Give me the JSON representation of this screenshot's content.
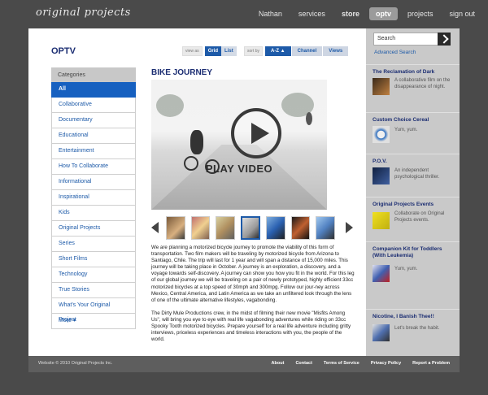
{
  "site": {
    "logo": "original projects"
  },
  "nav": {
    "items": [
      "Nathan",
      "services",
      "store",
      "optv",
      "projects",
      "sign out"
    ],
    "active": "optv"
  },
  "page": {
    "title": "OPTV"
  },
  "view": {
    "label": "view as",
    "grid": "Grid",
    "list": "List"
  },
  "sort": {
    "label": "sort by",
    "options": [
      "A-Z ▲",
      "Channel",
      "Views"
    ]
  },
  "categories": {
    "header": "Categories",
    "items": [
      "All",
      "Collaborative",
      "Documentary",
      "Educational",
      "Entertainment",
      "How To Collaborate",
      "Informational",
      "Inspirational",
      "Kids",
      "Original Projects",
      "Series",
      "Short Films",
      "Technology",
      "True Stories",
      "What's Your Original Project",
      "More ▾"
    ],
    "selected": "All"
  },
  "video": {
    "title": "BIKE JOURNEY",
    "play_label": "PLAY VIDEO",
    "thumbnail_count": 7,
    "selected_thumbnail": 4
  },
  "description": {
    "p1": "We are planning a motorized bicycle journey to promote the viability of this form of transportation. Two film makers will be traveling by motorized bicycle from Arizona to Santiago, Chile. The trip will last for 1 year and will span a distance of 15,000 miles. This journey will be taking place in October. A journey is an exploration, a discovery, and a voyage towards self-discovery. A journey can show you how you fit in the world. For this leg of our global journey we will be traveling on a pair of newly prototyped, highly efficient 33cc motorized bicycles at a top speed of 30mph and 300mpg. Follow our jour-ney across Mexico, Central America, and Latin America as we take an unfiltered look through the lens of one of the ultimate alternative lifestyles, vagabonding.",
    "p2": "The Dirty Mule Productions crew, in the midst of filming their new movie \"Misfits Among Us\", will bring you eye to eye with real life vagabonding adventures while riding on 33cc Spooky Tooth motorized bicycles. Prepare yourself for a real life adventure including gritty interviews, priceless experiences and timeless interactions with you, the people of the world."
  },
  "search": {
    "placeholder": "Search",
    "value": "Search",
    "advanced": "Advanced Search"
  },
  "featured": [
    {
      "title": "The Reclamation of Dark",
      "desc": "A collaborative film on the disappearance of night."
    },
    {
      "title": "Custom Choice Cereal",
      "desc": "Yum, yum."
    },
    {
      "title": "P.O.V.",
      "desc": "An independent psychological thriller."
    },
    {
      "title": "Original Projects Events",
      "desc": "Collaborate on Original Projects events."
    },
    {
      "title": "Companion Kit for Toddlers (With Leukemia)",
      "desc": "Yum, yum."
    },
    {
      "title": "Nicotine, I Banish Thee!!",
      "desc": "Let's break the habit."
    }
  ],
  "footer": {
    "copyright": "Website © 2010 Original Projects Inc.",
    "links": [
      "About",
      "Contact",
      "Terms of Service",
      "Privacy Policy",
      "Report a Problem"
    ]
  },
  "colors": {
    "accent": "#1d5aa8",
    "title": "#1b2d72",
    "background": "#4a4a4a"
  }
}
